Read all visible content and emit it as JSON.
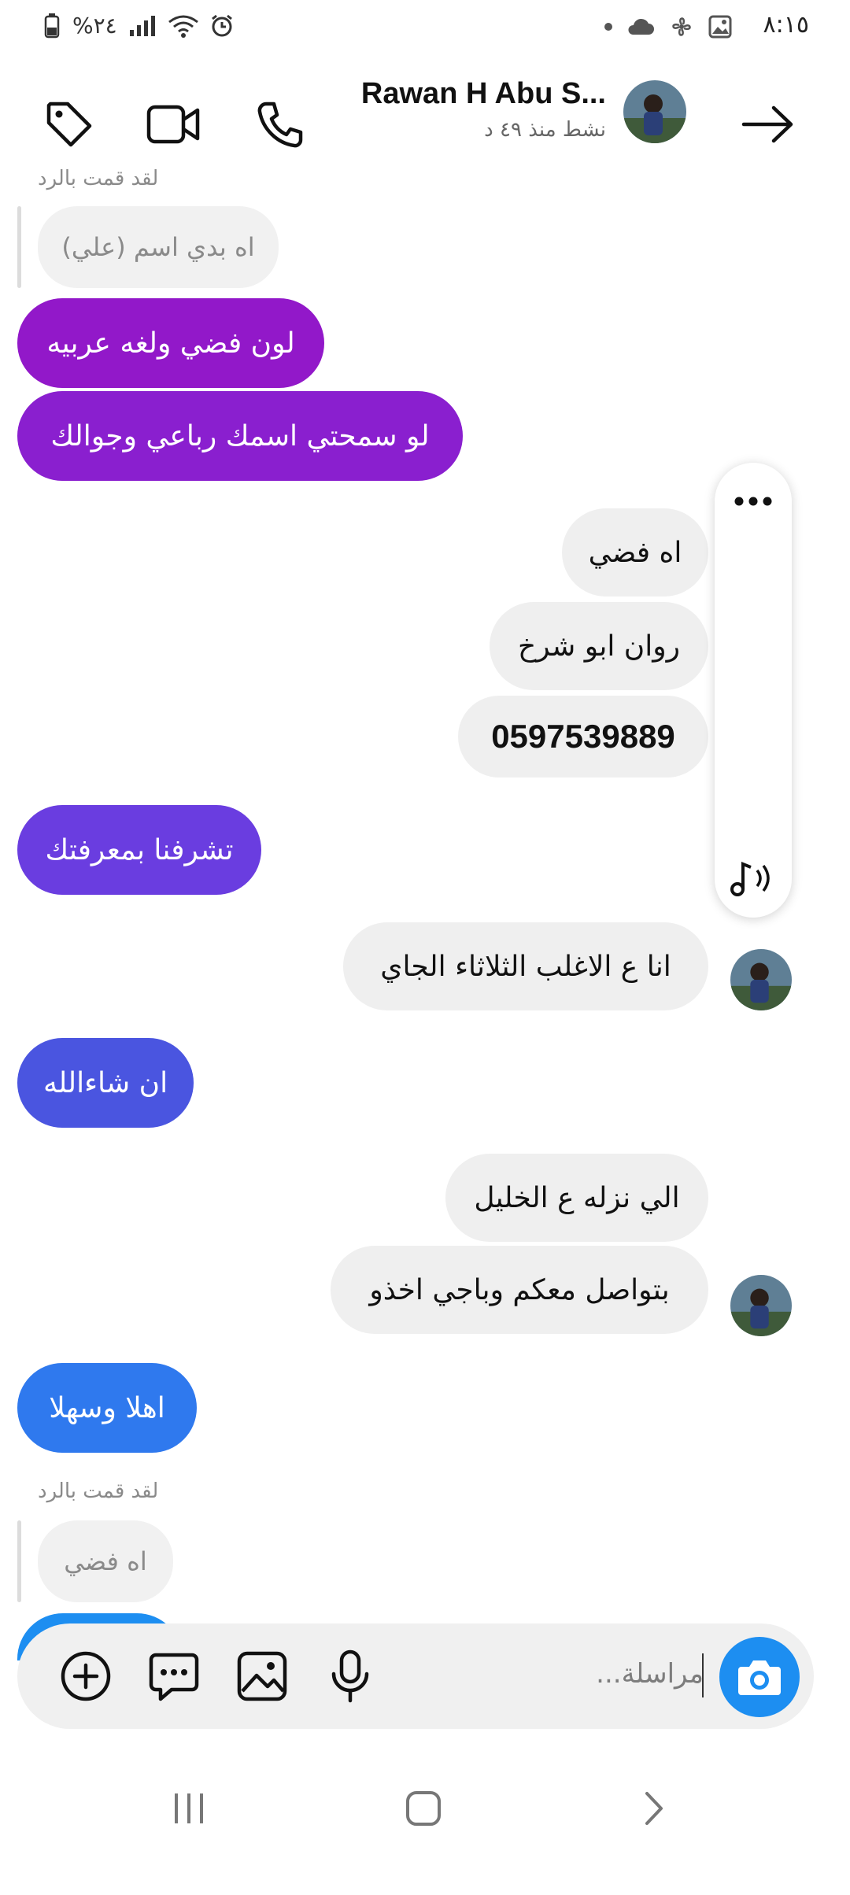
{
  "status_bar": {
    "time": "٨:١٥",
    "battery": "%٢٤"
  },
  "header": {
    "name": "Rawan H Abu S...",
    "status": "نشط منذ ٤٩ د",
    "back_icon": "arrow-right-icon",
    "call_icon": "phone-icon",
    "video_icon": "video-icon",
    "tag_icon": "tag-icon"
  },
  "thread": {
    "replied_label_1": "لقد قمت بالرد",
    "reply_quote_1": "اه بدي اسم (علي)",
    "m1": "لون فضي ولغه عربيه",
    "m2": "لو سمحتي اسمك رباعي وجوالك",
    "m3": "اه فضي",
    "m4": "روان ابو شرخ",
    "m5": "0597539889",
    "m6": "تشرفنا بمعرفتك",
    "m7": "انا ع الاغلب الثلاثاء الجاي",
    "m8": "ان شاءالله",
    "m9": "الي نزله ع الخليل",
    "m10": "بتواصل معكم وباجي اخذو",
    "m11": "اهلا وسهلا",
    "replied_label_2": "لقد قمت بالرد",
    "reply_quote_2": "اه فضي"
  },
  "composer": {
    "placeholder": "مراسلة..."
  },
  "colors": {
    "purple": "#9218c9",
    "violet": "#6a3de0",
    "indigo": "#4a55e0",
    "blue": "#2f79ee",
    "accent": "#1d8ef1"
  }
}
